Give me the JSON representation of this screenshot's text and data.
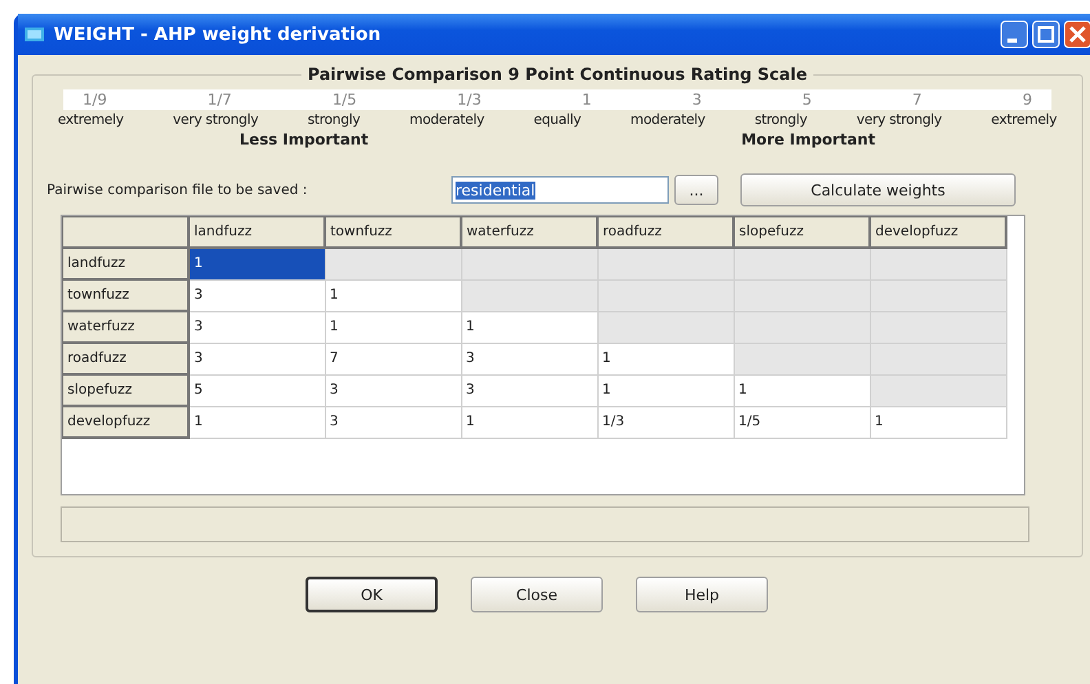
{
  "window": {
    "title": "WEIGHT - AHP weight derivation"
  },
  "scale": {
    "title": "Pairwise Comparison 9 Point Continuous Rating Scale",
    "values": [
      "1/9",
      "1/7",
      "1/5",
      "1/3",
      "1",
      "3",
      "5",
      "7",
      "9"
    ],
    "labels": [
      "extremely",
      "very strongly",
      "strongly",
      "moderately",
      "equally",
      "moderately",
      "strongly",
      "very strongly",
      "extremely"
    ],
    "less": "Less Important",
    "more": "More Important"
  },
  "file": {
    "label": "Pairwise comparison file to be saved :",
    "value": "residential",
    "browse": "...",
    "calculate": "Calculate weights"
  },
  "table": {
    "columns": [
      "landfuzz",
      "townfuzz",
      "waterfuzz",
      "roadfuzz",
      "slopefuzz",
      "developfuzz"
    ],
    "rows": [
      {
        "name": "landfuzz",
        "cells": [
          {
            "value": "1",
            "selected": true
          }
        ]
      },
      {
        "name": "townfuzz",
        "cells": [
          {
            "value": "3",
            "selected": false
          },
          {
            "value": "1",
            "selected": false
          }
        ]
      },
      {
        "name": "waterfuzz",
        "cells": [
          {
            "value": "3",
            "selected": false
          },
          {
            "value": "1",
            "selected": false
          },
          {
            "value": "1",
            "selected": false
          }
        ]
      },
      {
        "name": "roadfuzz",
        "cells": [
          {
            "value": "3",
            "selected": false
          },
          {
            "value": "7",
            "selected": false
          },
          {
            "value": "3",
            "selected": false
          },
          {
            "value": "1",
            "selected": false
          }
        ]
      },
      {
        "name": "slopefuzz",
        "cells": [
          {
            "value": "5",
            "selected": false
          },
          {
            "value": "3",
            "selected": false
          },
          {
            "value": "3",
            "selected": false
          },
          {
            "value": "1",
            "selected": false
          },
          {
            "value": "1",
            "selected": false
          }
        ]
      },
      {
        "name": "developfuzz",
        "cells": [
          {
            "value": "1",
            "selected": false
          },
          {
            "value": "3",
            "selected": false
          },
          {
            "value": "1",
            "selected": false
          },
          {
            "value": "1/3",
            "selected": false
          },
          {
            "value": "1/5",
            "selected": false
          },
          {
            "value": "1",
            "selected": false
          }
        ]
      }
    ]
  },
  "buttons": [
    {
      "label": "OK",
      "default": true
    },
    {
      "label": "Close",
      "default": false
    },
    {
      "label": "Help",
      "default": false
    }
  ]
}
